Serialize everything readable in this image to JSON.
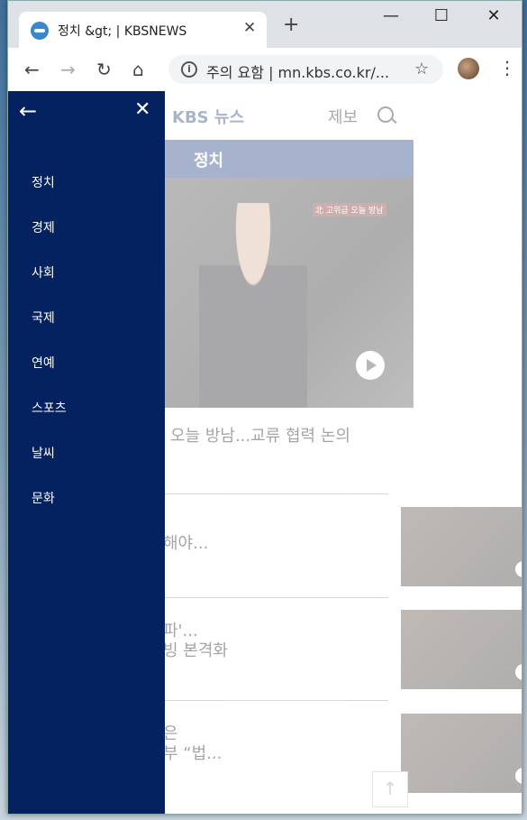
{
  "browser": {
    "tab_title": "정치 &gt; | KBSNEWS",
    "tab_close": "✕",
    "new_tab": "+",
    "window_controls": {
      "minimize": "—",
      "maximize": "☐",
      "close": "✕"
    },
    "nav": {
      "back": "←",
      "forward": "→",
      "reload": "↻",
      "home": "⌂"
    },
    "omnibox": {
      "security_label": "주의 요함",
      "separator": "|",
      "url": "mn.kbs.co.kr/..."
    },
    "star": "☆",
    "menu": "⋮"
  },
  "page": {
    "logo": "KBS 뉴스",
    "report_label": "제보",
    "hero": {
      "section_label": "정치",
      "caption_tag": "北 고위급 오늘 방남"
    },
    "headline": "오늘 방남...교류 협력 논의",
    "list_items": [
      {
        "lines": [
          "해야..."
        ]
      },
      {
        "lines": [
          "파'...",
          "빙 본격화"
        ]
      },
      {
        "lines": [
          "은",
          "부 “법..."
        ]
      }
    ],
    "top_button": "↑"
  },
  "drawer": {
    "back": "←",
    "close": "✕",
    "items": [
      "정치",
      "경제",
      "사회",
      "국제",
      "연예",
      "스포츠",
      "날씨",
      "문화"
    ]
  },
  "colors": {
    "drawer_bg": "#04225f",
    "accent": "#1b3a7a"
  }
}
